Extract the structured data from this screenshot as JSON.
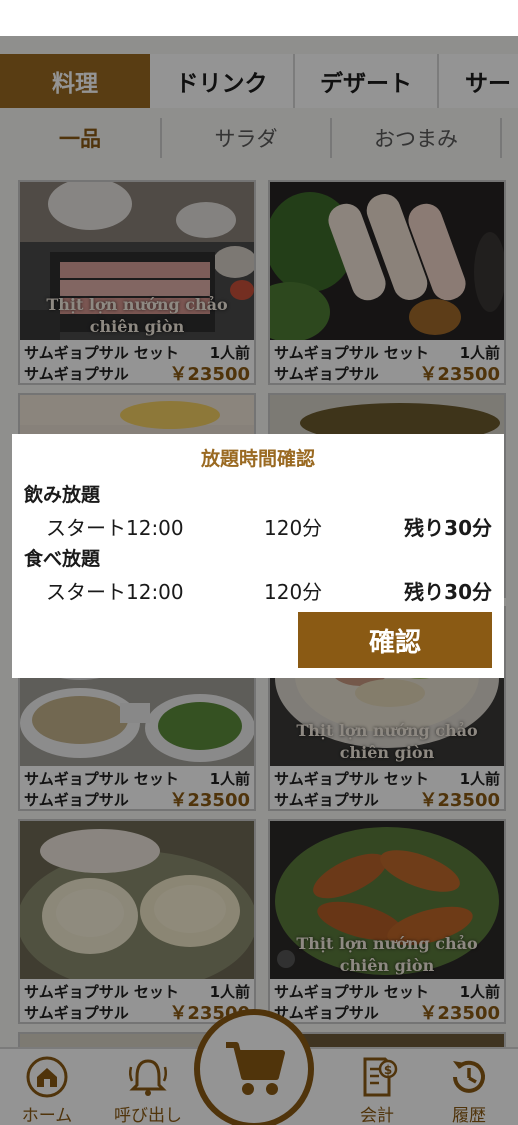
{
  "category_tabs": [
    "料理",
    "ドリンク",
    "デザート",
    "サー"
  ],
  "sub_tabs": [
    "一品",
    "サラダ",
    "おつまみ"
  ],
  "menu_items": [
    {
      "caption": "Thịt lợn nướng chảo chiên giòn",
      "name1": "サムギョプサル セット",
      "portion": "1人前",
      "name2": "サムギョプサル",
      "price": "￥23500"
    },
    {
      "caption": "",
      "name1": "サムギョプサル セット",
      "portion": "1人前",
      "name2": "サムギョプサル",
      "price": "￥23500"
    },
    {
      "caption": "",
      "name1": "",
      "portion": "",
      "name2": "",
      "price": ""
    },
    {
      "caption": "",
      "name1": "",
      "portion": "",
      "name2": "",
      "price": ""
    },
    {
      "caption": "",
      "name1": "サムギョプサル セット",
      "portion": "1人前",
      "name2": "サムギョプサル",
      "price": "￥23500"
    },
    {
      "caption": "Thịt lợn nướng chảo chiên giòn",
      "name1": "サムギョプサル セット",
      "portion": "1人前",
      "name2": "サムギョプサル",
      "price": "￥23500"
    },
    {
      "caption": "",
      "name1": "サムギョプサル セット",
      "portion": "1人前",
      "name2": "サムギョプサル",
      "price": "￥23500"
    },
    {
      "caption": "Thịt lợn nướng chảo chiên giòn",
      "name1": "サムギョプサル セット",
      "portion": "1人前",
      "name2": "サムギョプサル",
      "price": "￥23500"
    }
  ],
  "bottom_nav": {
    "home": "ホーム",
    "call": "呼び出し",
    "bill": "会計",
    "history": "履歴"
  },
  "modal": {
    "title": "放題時間確認",
    "drink": {
      "label": "飲み放題",
      "start": "スタート12:00",
      "duration": "120分",
      "remaining": "残り30分"
    },
    "food": {
      "label": "食べ放題",
      "start": "スタート12:00",
      "duration": "120分",
      "remaining": "残り30分"
    },
    "confirm_label": "確認"
  },
  "colors": {
    "accent": "#8a5a14",
    "tab_active": "#9a6a22"
  },
  "icons": [
    "home-icon",
    "bell-icon",
    "cart-icon",
    "receipt-icon",
    "history-icon"
  ]
}
